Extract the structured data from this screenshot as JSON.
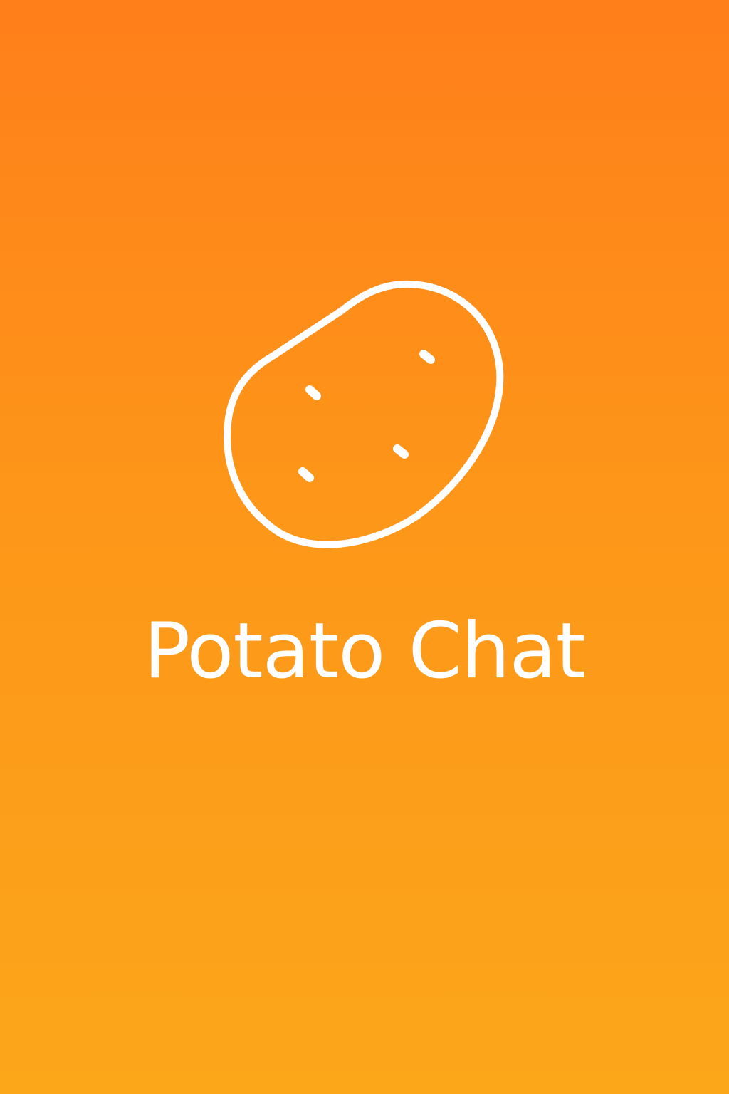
{
  "app": {
    "name": "Potato Chat"
  },
  "splash": {
    "logo_icon": "potato-icon",
    "background_top": "#FF7F1A",
    "background_bottom": "#FCA61A",
    "foreground": "#FFFFFF"
  }
}
